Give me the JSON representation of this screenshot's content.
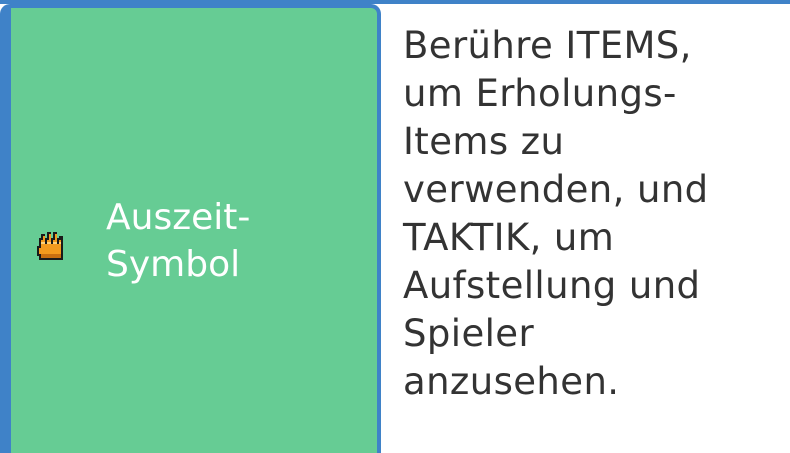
{
  "left_cell": {
    "icon": "timeout-hand-icon",
    "label_lines": [
      "Auszeit-",
      "Symbol"
    ]
  },
  "right_cell": {
    "lines": [
      "Berühre ITEMS,",
      "um Erholungs-",
      "Items zu",
      "verwenden, und",
      "TAKTIK, um",
      "Aufstellung und",
      "Spieler",
      "anzusehen."
    ]
  },
  "colors": {
    "border": "#3f82c8",
    "cell_green": "#66cc94",
    "icon_orange": "#f39a1e"
  }
}
